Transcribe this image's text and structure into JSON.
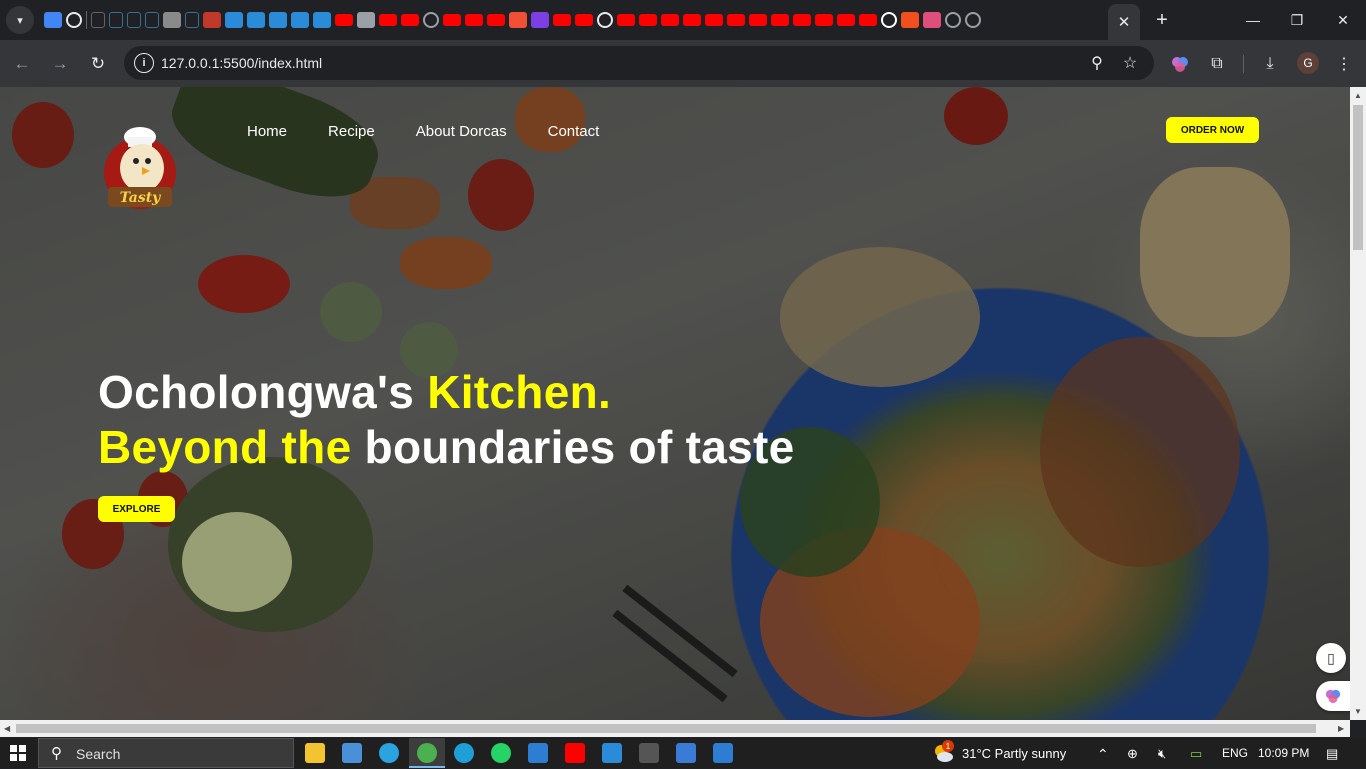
{
  "browser": {
    "url": "127.0.0.1:5500/index.html",
    "tab_menu_icon": "chevron-down-icon",
    "close_tab_symbol": "✕",
    "new_tab_symbol": "+",
    "minimize_symbol": "—",
    "restore_symbol": "❐",
    "close_window_symbol": "✕",
    "back_symbol": "←",
    "forward_symbol": "→",
    "reload_symbol": "↻",
    "site_info_symbol": "i",
    "zoom_symbol": "⚲",
    "bookmark_symbol": "☆",
    "download_symbol": "⤓",
    "more_symbol": "⋮",
    "profile_initial": "G",
    "extensions_symbol": "⧉",
    "tab_favicons": [
      {
        "icon": "docs-icon",
        "color": "#4285f4"
      },
      {
        "icon": "github-icon",
        "color": "#e8eaed"
      },
      {
        "icon": "separator",
        "color": "#5f6368"
      },
      {
        "icon": "page-icon",
        "color": "#5f6368"
      },
      {
        "icon": "page-icon",
        "color": "#3c6e8f"
      },
      {
        "icon": "page-icon",
        "color": "#3c6e8f"
      },
      {
        "icon": "page-icon",
        "color": "#3c6e8f"
      },
      {
        "icon": "image-icon",
        "color": "#8a8a8a"
      },
      {
        "icon": "page-icon",
        "color": "#3c6e8f"
      },
      {
        "icon": "image-icon",
        "color": "#c0392b"
      },
      {
        "icon": "vscode-icon",
        "color": "#2a8cd8"
      },
      {
        "icon": "vscode-icon",
        "color": "#2a8cd8"
      },
      {
        "icon": "vscode-icon",
        "color": "#2a8cd8"
      },
      {
        "icon": "vscode-icon",
        "color": "#2a8cd8"
      },
      {
        "icon": "vscode-icon",
        "color": "#2a8cd8"
      },
      {
        "icon": "youtube-icon",
        "color": "#ff0000"
      },
      {
        "icon": "vs-icon",
        "color": "#9aa0a6"
      },
      {
        "icon": "youtube-icon",
        "color": "#ff0000"
      },
      {
        "icon": "youtube-icon",
        "color": "#ff0000"
      },
      {
        "icon": "globe-icon",
        "color": "#9aa0a6"
      },
      {
        "icon": "youtube-icon",
        "color": "#ff0000"
      },
      {
        "icon": "youtube-icon",
        "color": "#ff0000"
      },
      {
        "icon": "youtube-icon",
        "color": "#ff0000"
      },
      {
        "icon": "git-icon",
        "color": "#f05033"
      },
      {
        "icon": "vs-purple-icon",
        "color": "#7b3fe4"
      },
      {
        "icon": "youtube-icon",
        "color": "#ff0000"
      },
      {
        "icon": "youtube-icon",
        "color": "#ff0000"
      },
      {
        "icon": "github-icon",
        "color": "#e8eaed"
      },
      {
        "icon": "youtube-icon",
        "color": "#ff0000"
      },
      {
        "icon": "youtube-icon",
        "color": "#ff0000"
      },
      {
        "icon": "youtube-icon",
        "color": "#ff0000"
      },
      {
        "icon": "youtube-icon",
        "color": "#ff0000"
      },
      {
        "icon": "youtube-icon",
        "color": "#ff0000"
      },
      {
        "icon": "youtube-icon",
        "color": "#ff0000"
      },
      {
        "icon": "youtube-icon",
        "color": "#ff0000"
      },
      {
        "icon": "youtube-icon",
        "color": "#ff0000"
      },
      {
        "icon": "youtube-icon",
        "color": "#ff0000"
      },
      {
        "icon": "youtube-icon",
        "color": "#ff0000"
      },
      {
        "icon": "youtube-icon",
        "color": "#ff0000"
      },
      {
        "icon": "youtube-icon",
        "color": "#ff0000"
      },
      {
        "icon": "google-icon",
        "color": "#ffffff"
      },
      {
        "icon": "figma-icon",
        "color": "#f24e1e"
      },
      {
        "icon": "app-icon",
        "color": "#e04f7b"
      },
      {
        "icon": "globe-icon",
        "color": "#9aa0a6"
      },
      {
        "icon": "globe-icon",
        "color": "#9aa0a6"
      }
    ]
  },
  "site": {
    "logo_text": "Tasty",
    "nav": [
      "Home",
      "Recipe",
      "About Dorcas",
      "Contact"
    ],
    "order_button": "ORDER NOW",
    "hero": {
      "line1_white": "Ocholongwa's ",
      "line1_yellow": "Kitchen.",
      "line2_yellow": "Beyond the ",
      "line2_white": "boundaries of taste"
    },
    "explore_button": "EXPLORE",
    "accent_color": "#ffff00"
  },
  "taskbar": {
    "search_label": "Search",
    "weather": "31°C  Partly sunny",
    "language": "ENG",
    "time": "10:09 PM",
    "weather_badge": "1",
    "apps": [
      {
        "icon": "file-explorer-icon",
        "color": "#f4c430"
      },
      {
        "icon": "store-icon",
        "color": "#4a90d9"
      },
      {
        "icon": "telegram-icon",
        "color": "#2aa3e0"
      },
      {
        "icon": "chrome-icon",
        "color": "#4caf50"
      },
      {
        "icon": "edge-icon",
        "color": "#1e9fd8"
      },
      {
        "icon": "whatsapp-icon",
        "color": "#25d366"
      },
      {
        "icon": "phone-icon",
        "color": "#2d7dd2"
      },
      {
        "icon": "youtube-icon",
        "color": "#ff0000"
      },
      {
        "icon": "vscode-icon",
        "color": "#2a8cd8"
      },
      {
        "icon": "terminal-icon",
        "color": "#555555"
      },
      {
        "icon": "azure-icon",
        "color": "#3a7bd5"
      },
      {
        "icon": "app-icon",
        "color": "#2d7dd2"
      }
    ]
  }
}
